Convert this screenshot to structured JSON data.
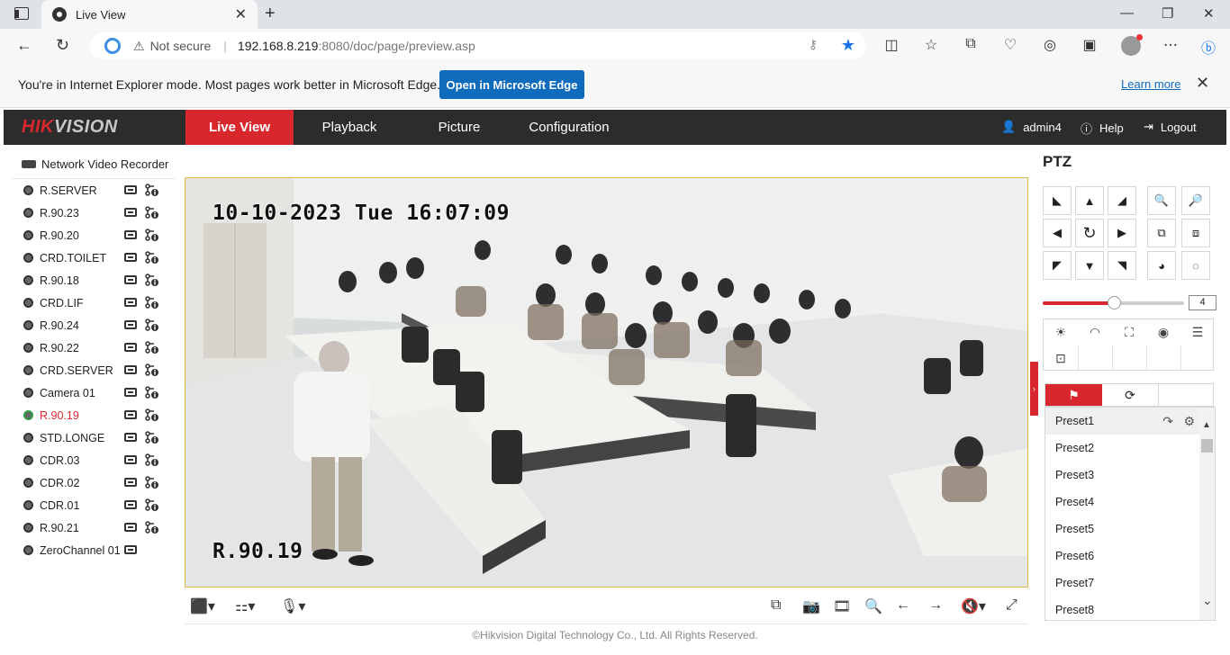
{
  "browser": {
    "tab_title": "Live View",
    "not_secure": "Not secure",
    "url_host": "192.168.8.219",
    "url_rest": ":8080/doc/page/preview.asp"
  },
  "ie_banner": {
    "message": "You're in Internet Explorer mode. Most pages work better in Microsoft Edge.",
    "open_button": "Open in Microsoft Edge",
    "learn_more": "Learn more"
  },
  "header": {
    "logo_red": "HIK",
    "logo_grey": "VISION",
    "tabs": [
      "Live View",
      "Playback",
      "Picture",
      "Configuration"
    ],
    "user": "admin4",
    "help": "Help",
    "logout": "Logout"
  },
  "device": {
    "name": "Network Video Recorder"
  },
  "channels": [
    {
      "name": "R.SERVER",
      "state": "normal"
    },
    {
      "name": "R.90.23",
      "state": "normal"
    },
    {
      "name": "R.90.20",
      "state": "normal"
    },
    {
      "name": "CRD.TOILET",
      "state": "normal"
    },
    {
      "name": "R.90.18",
      "state": "normal"
    },
    {
      "name": "CRD.LIF",
      "state": "normal"
    },
    {
      "name": "R.90.24",
      "state": "normal"
    },
    {
      "name": "R.90.22",
      "state": "normal"
    },
    {
      "name": "CRD.SERVER",
      "state": "normal"
    },
    {
      "name": "Camera 01",
      "state": "normal"
    },
    {
      "name": "R.90.19",
      "state": "live"
    },
    {
      "name": "STD.LONGE",
      "state": "normal"
    },
    {
      "name": "CDR.03",
      "state": "normal"
    },
    {
      "name": "CDR.02",
      "state": "normal"
    },
    {
      "name": "CDR.01",
      "state": "normal"
    },
    {
      "name": "R.90.21",
      "state": "normal"
    },
    {
      "name": "ZeroChannel 01",
      "state": "zero"
    }
  ],
  "video": {
    "timestamp": "10-10-2023 Tue 16:07:09",
    "camera_label": "R.90.19"
  },
  "ptz": {
    "title": "PTZ",
    "speed": "4",
    "speed_level": 4,
    "speed_max": 7,
    "presets": [
      "Preset1",
      "Preset2",
      "Preset3",
      "Preset4",
      "Preset5",
      "Preset6",
      "Preset7",
      "Preset8"
    ]
  },
  "footer": {
    "copyright": "©Hikvision Digital Technology Co., Ltd. All Rights Reserved."
  },
  "colors": {
    "accent": "#d9272e",
    "header_bg": "#2c2c2c",
    "edge_blue": "#0f6cbd"
  }
}
